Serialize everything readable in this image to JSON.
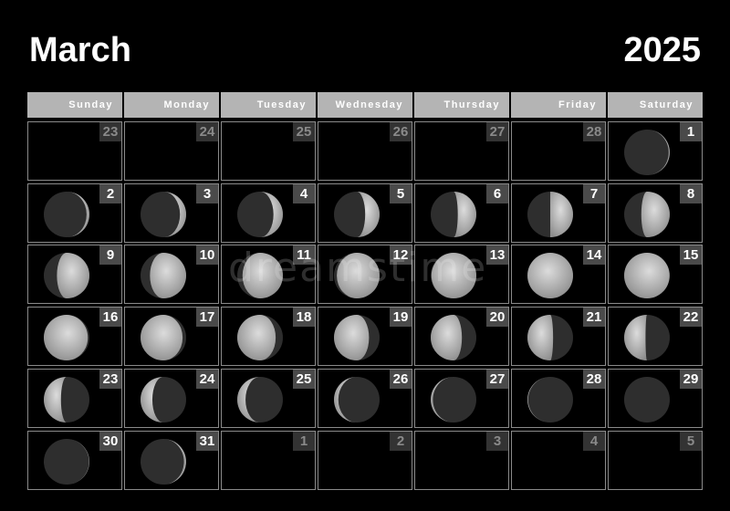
{
  "title": {
    "month": "March",
    "year": "2025"
  },
  "weekdays": [
    "Sunday",
    "Monday",
    "Tuesday",
    "Wednesday",
    "Thursday",
    "Friday",
    "Saturday"
  ],
  "colors": {
    "background": "#000000",
    "header": "#b4b4b4",
    "badge": "#4a4a4a",
    "badge_other": "#333333",
    "moon_lit": "#c8c8c8",
    "moon_dark": "#2e2e2e"
  },
  "days": [
    {
      "day": "23",
      "other": true
    },
    {
      "day": "24",
      "other": true
    },
    {
      "day": "25",
      "other": true
    },
    {
      "day": "26",
      "other": true
    },
    {
      "day": "27",
      "other": true
    },
    {
      "day": "28",
      "other": true
    },
    {
      "day": "1",
      "phase": 0.05
    },
    {
      "day": "2",
      "phase": 0.08
    },
    {
      "day": "3",
      "phase": 0.12
    },
    {
      "day": "4",
      "phase": 0.15
    },
    {
      "day": "5",
      "phase": 0.19
    },
    {
      "day": "6",
      "phase": 0.22
    },
    {
      "day": "7",
      "phase": 0.25
    },
    {
      "day": "8",
      "phase": 0.29
    },
    {
      "day": "9",
      "phase": 0.32
    },
    {
      "day": "10",
      "phase": 0.35
    },
    {
      "day": "11",
      "phase": 0.39
    },
    {
      "day": "12",
      "phase": 0.42
    },
    {
      "day": "13",
      "phase": 0.46
    },
    {
      "day": "14",
      "phase": 0.49
    },
    {
      "day": "15",
      "phase": 0.52
    },
    {
      "day": "16",
      "phase": 0.56
    },
    {
      "day": "17",
      "phase": 0.59
    },
    {
      "day": "18",
      "phase": 0.63
    },
    {
      "day": "19",
      "phase": 0.66
    },
    {
      "day": "20",
      "phase": 0.69
    },
    {
      "day": "21",
      "phase": 0.73
    },
    {
      "day": "22",
      "phase": 0.76
    },
    {
      "day": "23",
      "phase": 0.79
    },
    {
      "day": "24",
      "phase": 0.83
    },
    {
      "day": "25",
      "phase": 0.86
    },
    {
      "day": "26",
      "phase": 0.9
    },
    {
      "day": "27",
      "phase": 0.93
    },
    {
      "day": "28",
      "phase": 0.96
    },
    {
      "day": "29",
      "phase": 0.995
    },
    {
      "day": "30",
      "phase": 0.03
    },
    {
      "day": "31",
      "phase": 0.07
    },
    {
      "day": "1",
      "other": true
    },
    {
      "day": "2",
      "other": true
    },
    {
      "day": "3",
      "other": true
    },
    {
      "day": "4",
      "other": true
    },
    {
      "day": "5",
      "other": true
    }
  ],
  "watermark": "dreamstime"
}
